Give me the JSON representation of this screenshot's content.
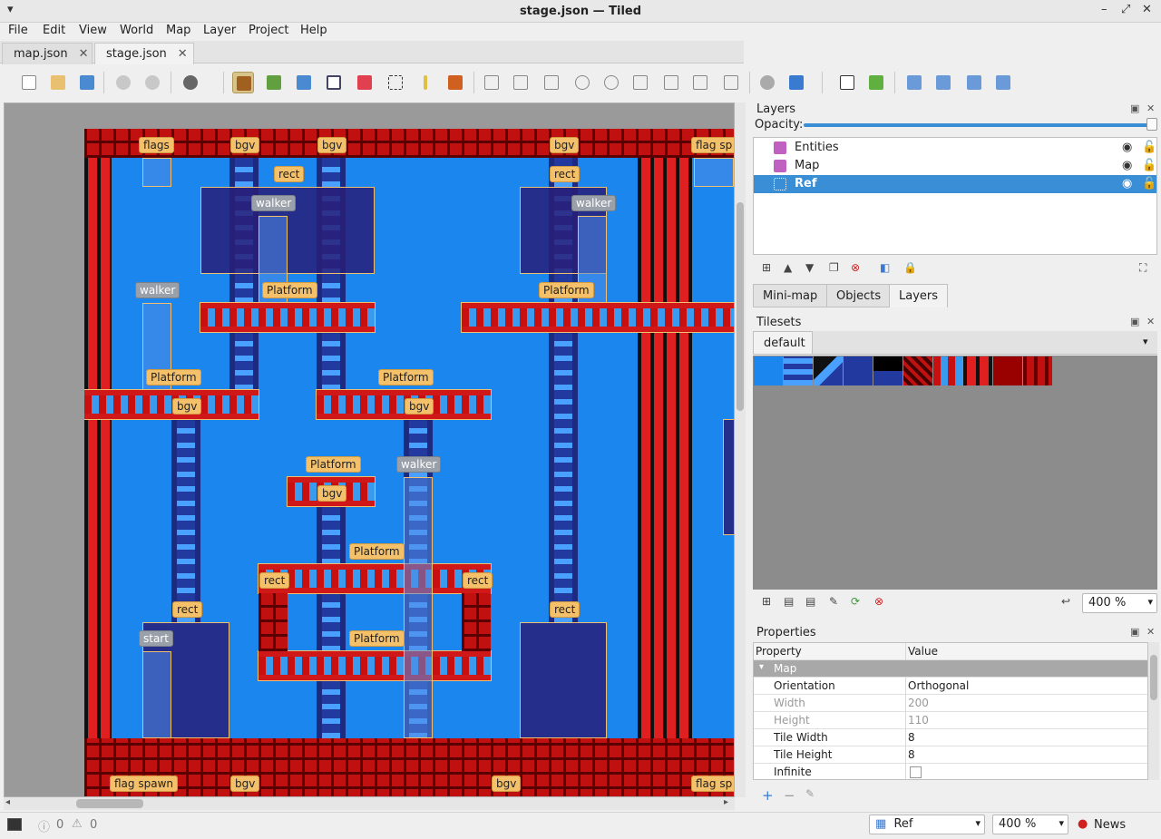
{
  "window": {
    "title": "stage.json — Tiled"
  },
  "menu": [
    "File",
    "Edit",
    "View",
    "World",
    "Map",
    "Layer",
    "Project",
    "Help"
  ],
  "tabs": [
    {
      "label": "map.json",
      "active": false
    },
    {
      "label": "stage.json",
      "active": true
    }
  ],
  "map_labels": [
    "flags",
    "bgv",
    "bgv",
    "bgv",
    "flag sp",
    "rect",
    "rect",
    "walker",
    "walker",
    "walker",
    "Platform",
    "Platform",
    "Platform",
    "Platform",
    "bgv",
    "bgv",
    "Platform",
    "walker",
    "bgv",
    "Platform",
    "rect",
    "rect",
    "rect",
    "rect",
    "start",
    "Platform",
    "flag spawn",
    "bgv",
    "bgv",
    "flag sp"
  ],
  "layers_panel": {
    "title": "Layers",
    "opacity_label": "Opacity:",
    "items": [
      {
        "name": "Entities",
        "selected": false
      },
      {
        "name": "Map",
        "selected": false
      },
      {
        "name": "Ref",
        "selected": true
      }
    ],
    "tabs": [
      "Mini-map",
      "Objects",
      "Layers"
    ]
  },
  "tilesets_panel": {
    "title": "Tilesets",
    "tab": "default",
    "zoom": "400 %"
  },
  "properties_panel": {
    "title": "Properties",
    "header_property": "Property",
    "header_value": "Value",
    "group": "Map",
    "rows": [
      {
        "key": "Orientation",
        "value": "Orthogonal",
        "readonly": false
      },
      {
        "key": "Width",
        "value": "200",
        "readonly": true
      },
      {
        "key": "Height",
        "value": "110",
        "readonly": true
      },
      {
        "key": "Tile Width",
        "value": "8",
        "readonly": false
      },
      {
        "key": "Tile Height",
        "value": "8",
        "readonly": false
      },
      {
        "key": "Infinite",
        "value": "",
        "readonly": false
      }
    ]
  },
  "status": {
    "errors": "0",
    "warnings": "0",
    "layer": "Ref",
    "zoom": "400 %",
    "news": "News"
  },
  "colors": {
    "accent": "#3a8ed6",
    "map_bg": "#1a86ee",
    "brick": "#c01010",
    "label": "#f5c06a"
  }
}
